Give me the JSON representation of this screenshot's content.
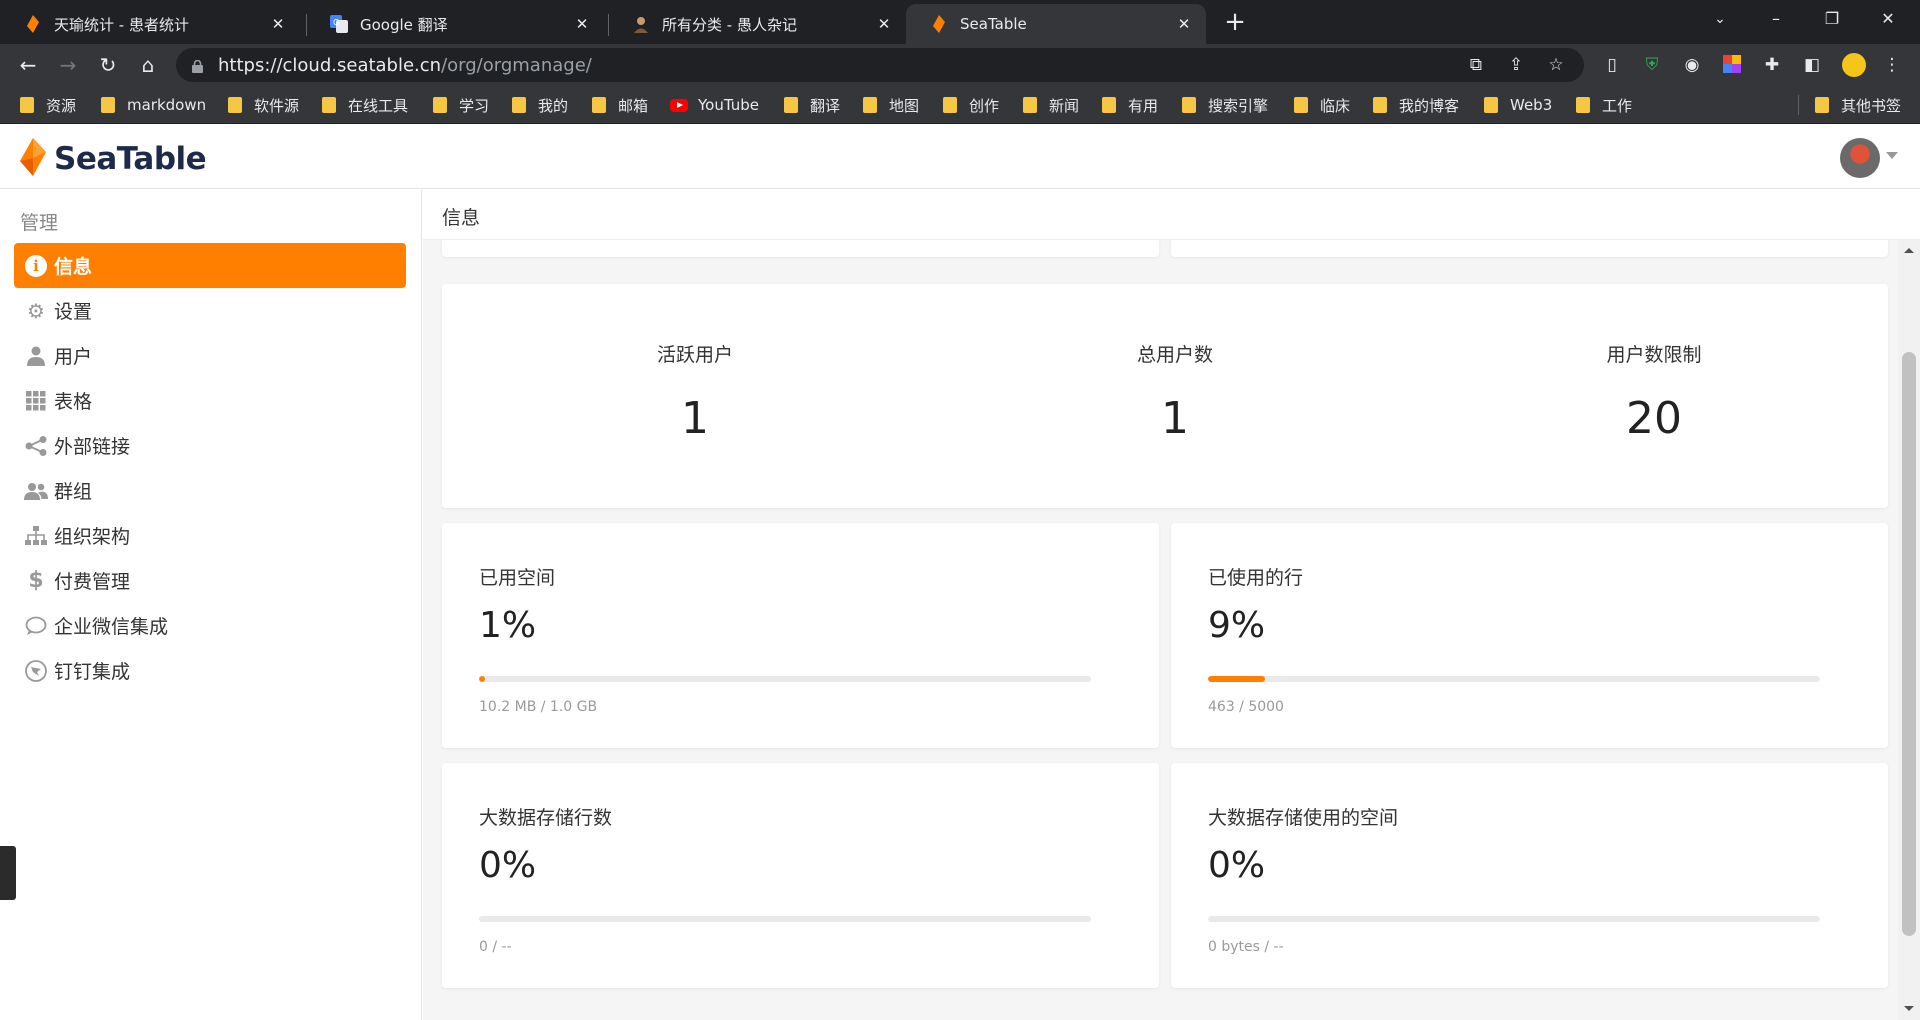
{
  "browser": {
    "tabs": [
      {
        "title": "天瑜统计 - 患者统计",
        "icon": "seatable-favicon"
      },
      {
        "title": "Google 翻译",
        "icon": "google-translate-favicon"
      },
      {
        "title": "所有分类 - 愚人杂记",
        "icon": "avatar-favicon"
      },
      {
        "title": "SeaTable",
        "icon": "seatable-favicon"
      }
    ],
    "close_glyph": "✕",
    "new_tab_glyph": "+",
    "url_host": "https://cloud.seatable.cn",
    "url_path": "/org/orgmanage/",
    "bookmarks": [
      "资源",
      "markdown",
      "软件源",
      "在线工具",
      "学习",
      "我的",
      "邮箱",
      "YouTube",
      "翻译",
      "地图",
      "创作",
      "新闻",
      "有用",
      "搜索引擎",
      "临床",
      "我的博客",
      "Web3",
      "工作"
    ],
    "other_bookmarks": "其他书签"
  },
  "app": {
    "logo_text": "SeaTable",
    "brand_color": "#ff8000"
  },
  "sidebar": {
    "heading": "管理",
    "items": [
      {
        "label": "信息",
        "icon": "info-icon",
        "active": true
      },
      {
        "label": "设置",
        "icon": "gear-icon"
      },
      {
        "label": "用户",
        "icon": "user-icon"
      },
      {
        "label": "表格",
        "icon": "grid-icon"
      },
      {
        "label": "外部链接",
        "icon": "share-icon"
      },
      {
        "label": "群组",
        "icon": "group-icon"
      },
      {
        "label": "组织架构",
        "icon": "org-chart-icon"
      },
      {
        "label": "付费管理",
        "icon": "dollar-icon"
      },
      {
        "label": "企业微信集成",
        "icon": "chat-icon"
      },
      {
        "label": "钉钉集成",
        "icon": "dingtalk-icon"
      }
    ]
  },
  "main": {
    "title": "信息",
    "stats": [
      {
        "label": "活跃用户",
        "value": "1"
      },
      {
        "label": "总用户数",
        "value": "1"
      },
      {
        "label": "用户数限制",
        "value": "20"
      }
    ],
    "metrics": [
      {
        "label": "已用空间",
        "percent": "1%",
        "progress": 0.01,
        "detail": "10.2 MB / 1.0 GB"
      },
      {
        "label": "已使用的行",
        "percent": "9%",
        "progress": 0.0926,
        "detail": "463 / 5000"
      },
      {
        "label": "大数据存储行数",
        "percent": "0%",
        "progress": 0,
        "detail": "0 / --"
      },
      {
        "label": "大数据存储使用的空间",
        "percent": "0%",
        "progress": 0,
        "detail": "0 bytes / --"
      }
    ]
  }
}
